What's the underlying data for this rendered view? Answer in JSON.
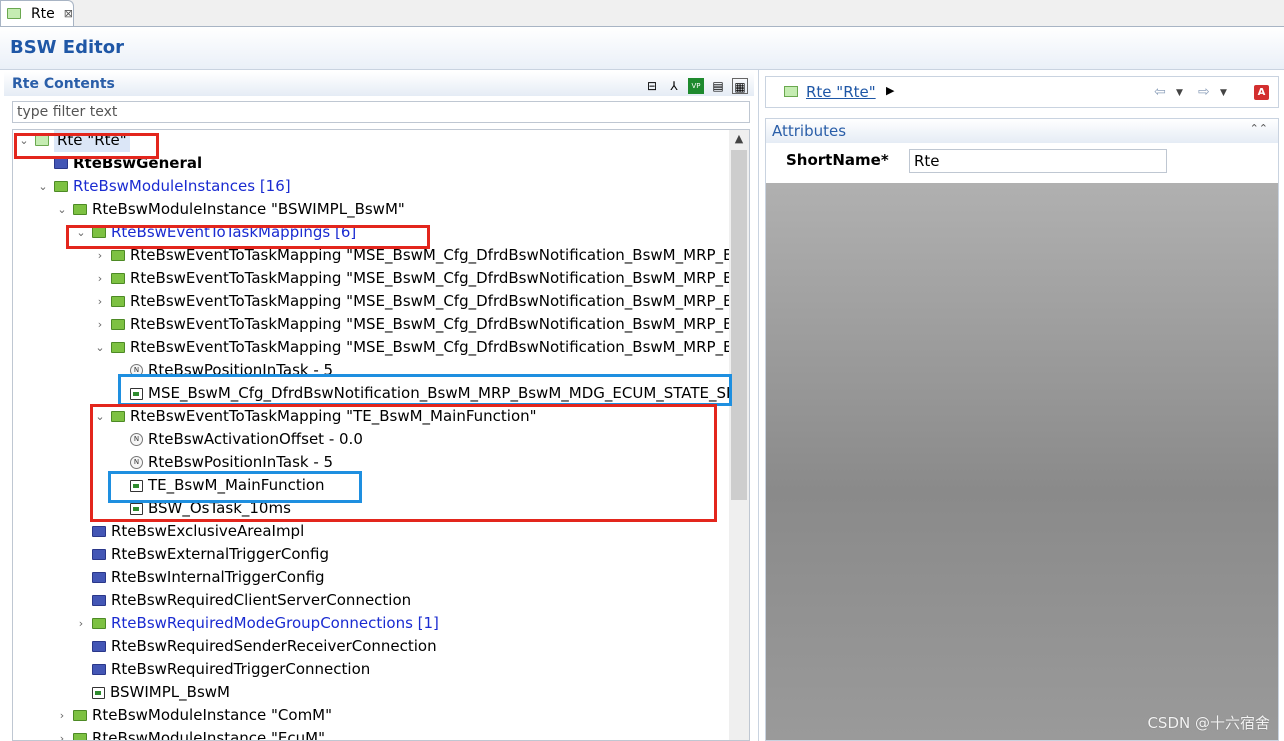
{
  "tab": {
    "label": "Rte",
    "close": "⊠"
  },
  "editor_title": "BSW Editor",
  "left": {
    "section_title": "Rte Contents",
    "filter_placeholder": "type filter text",
    "tree": [
      {
        "label": "Rte \"Rte\"",
        "style": "normal",
        "icon": "green-light",
        "toggle": "⌄"
      },
      {
        "label": "RteBswGeneral",
        "style": "bold",
        "icon": "blue",
        "toggle": ""
      },
      {
        "label": "RteBswModuleInstances [16]",
        "style": "blue",
        "icon": "green",
        "toggle": "⌄"
      },
      {
        "label": "RteBswModuleInstance \"BSWIMPL_BswM\"",
        "style": "normal",
        "icon": "green",
        "toggle": "⌄"
      },
      {
        "label": "RteBswEventToTaskMappings [6]",
        "style": "blue",
        "icon": "green",
        "toggle": "⌄"
      },
      {
        "label": "RteBswEventToTaskMapping \"MSE_BswM_Cfg_DfrdBswNotification_BswM_MRP_B",
        "style": "normal",
        "icon": "green",
        "toggle": "›"
      },
      {
        "label": "RteBswEventToTaskMapping \"MSE_BswM_Cfg_DfrdBswNotification_BswM_MRP_B",
        "style": "normal",
        "icon": "green",
        "toggle": "›"
      },
      {
        "label": "RteBswEventToTaskMapping \"MSE_BswM_Cfg_DfrdBswNotification_BswM_MRP_B",
        "style": "normal",
        "icon": "green",
        "toggle": "›"
      },
      {
        "label": "RteBswEventToTaskMapping \"MSE_BswM_Cfg_DfrdBswNotification_BswM_MRP_B",
        "style": "normal",
        "icon": "green",
        "toggle": "›"
      },
      {
        "label": "RteBswEventToTaskMapping \"MSE_BswM_Cfg_DfrdBswNotification_BswM_MRP_B",
        "style": "normal",
        "icon": "green",
        "toggle": "⌄"
      },
      {
        "label": "RteBswPositionInTask - 5",
        "style": "normal",
        "icon": "num",
        "toggle": ""
      },
      {
        "label": "MSE_BswM_Cfg_DfrdBswNotification_BswM_MRP_BswM_MDG_ECUM_STATE_SI",
        "style": "normal",
        "icon": "ref",
        "toggle": ""
      },
      {
        "label": "RteBswEventToTaskMapping \"TE_BswM_MainFunction\"",
        "style": "normal",
        "icon": "green",
        "toggle": "⌄"
      },
      {
        "label": "RteBswActivationOffset - 0.0",
        "style": "normal",
        "icon": "num",
        "toggle": ""
      },
      {
        "label": "RteBswPositionInTask - 5",
        "style": "normal",
        "icon": "num",
        "toggle": ""
      },
      {
        "label": "TE_BswM_MainFunction",
        "style": "normal",
        "icon": "ref",
        "toggle": ""
      },
      {
        "label": "BSW_OsTask_10ms",
        "style": "normal",
        "icon": "ref",
        "toggle": ""
      },
      {
        "label": "RteBswExclusiveAreaImpl",
        "style": "normal",
        "icon": "blue",
        "toggle": ""
      },
      {
        "label": "RteBswExternalTriggerConfig",
        "style": "normal",
        "icon": "blue",
        "toggle": ""
      },
      {
        "label": "RteBswInternalTriggerConfig",
        "style": "normal",
        "icon": "blue",
        "toggle": ""
      },
      {
        "label": "RteBswRequiredClientServerConnection",
        "style": "normal",
        "icon": "blue",
        "toggle": ""
      },
      {
        "label": "RteBswRequiredModeGroupConnections [1]",
        "style": "blue",
        "icon": "green",
        "toggle": "›"
      },
      {
        "label": "RteBswRequiredSenderReceiverConnection",
        "style": "normal",
        "icon": "blue",
        "toggle": ""
      },
      {
        "label": "RteBswRequiredTriggerConnection",
        "style": "normal",
        "icon": "blue",
        "toggle": ""
      },
      {
        "label": "BSWIMPL_BswM",
        "style": "normal",
        "icon": "ref",
        "toggle": ""
      },
      {
        "label": "RteBswModuleInstance \"ComM\"",
        "style": "normal",
        "icon": "green",
        "toggle": "›"
      },
      {
        "label": "RteBswModuleInstance \"EcuM\"",
        "style": "normal",
        "icon": "green",
        "toggle": "›"
      }
    ]
  },
  "right": {
    "crumb": "Rte \"Rte\"",
    "attributes_title": "Attributes",
    "short_name_label": "ShortName*",
    "short_name_value": "Rte"
  },
  "watermark": "CSDN @十六宿舍"
}
